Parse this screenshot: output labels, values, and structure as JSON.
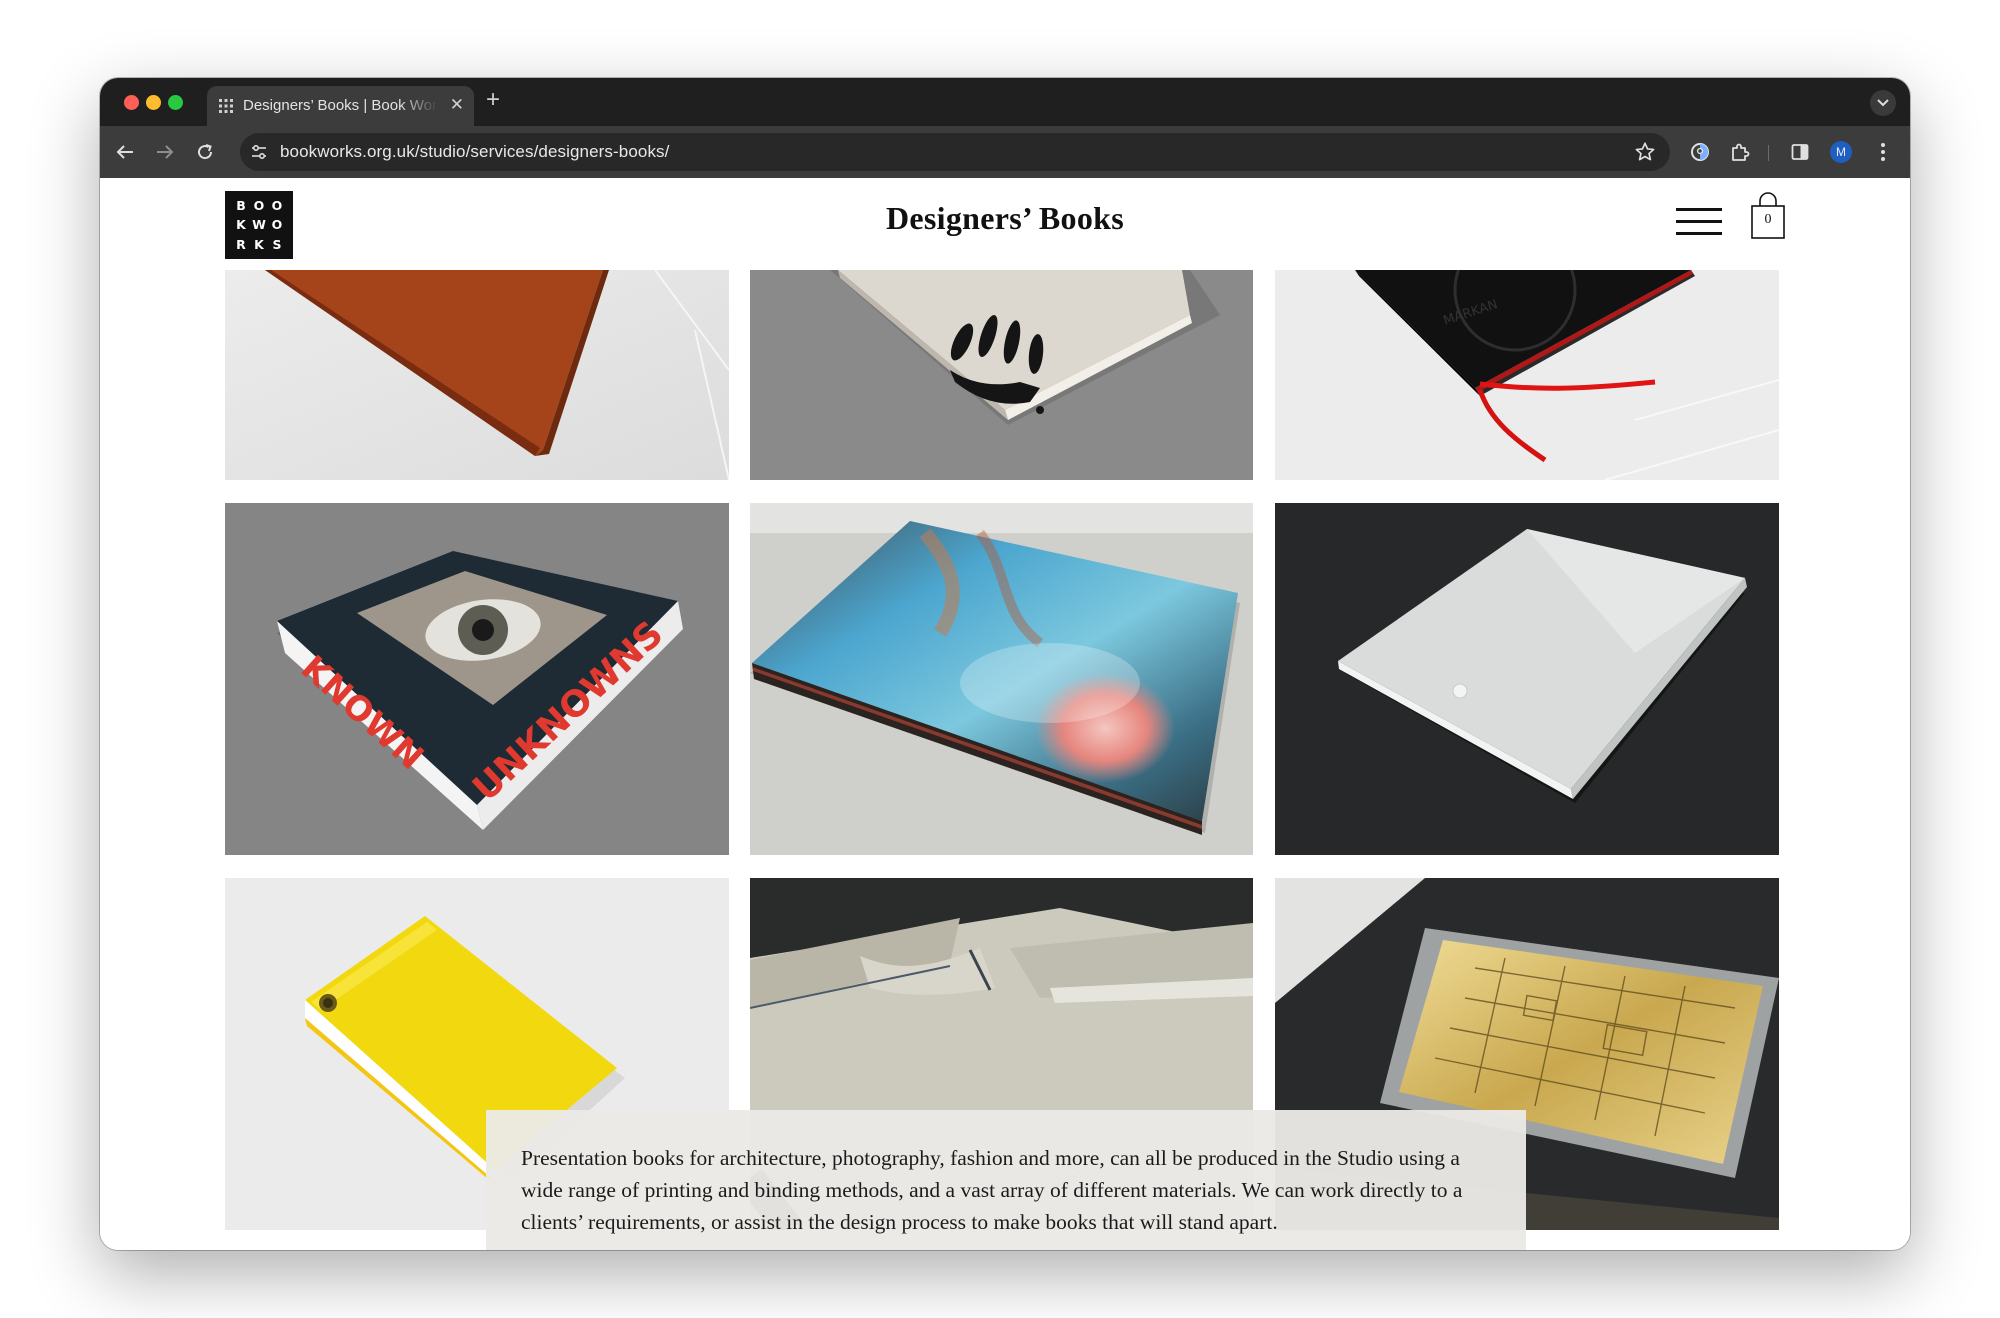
{
  "browser": {
    "tab_title": "Designers’ Books | Book Works",
    "tab_close": "✕",
    "new_tab": "+",
    "url": "bookworks.org.uk/studio/services/designers-books/",
    "profile_initial": "M"
  },
  "header": {
    "logo_letters": [
      "B",
      "O",
      "O",
      "K",
      "W",
      "O",
      "R",
      "K",
      "S"
    ],
    "title": "Designers’ Books",
    "basket_count": "0"
  },
  "caption": {
    "text": "Presentation books for architecture, photography, fashion and more, can all be produced in the Studio using a wide range of printing and binding methods, and a vast array of different materials. We can work directly to a clients’ requirements, or assist in the design process to make books that will stand apart."
  },
  "gallery": {
    "book_spine_words": [
      "KNOWN",
      "UNKNOWNS"
    ],
    "embossed_cover_text": "MARKAN"
  },
  "colors": {
    "chrome_dark": "#1f1f1f",
    "toolbar": "#3c3c3c",
    "caption_bg": "#ebe9e6",
    "spine_red": "#e0392f"
  }
}
